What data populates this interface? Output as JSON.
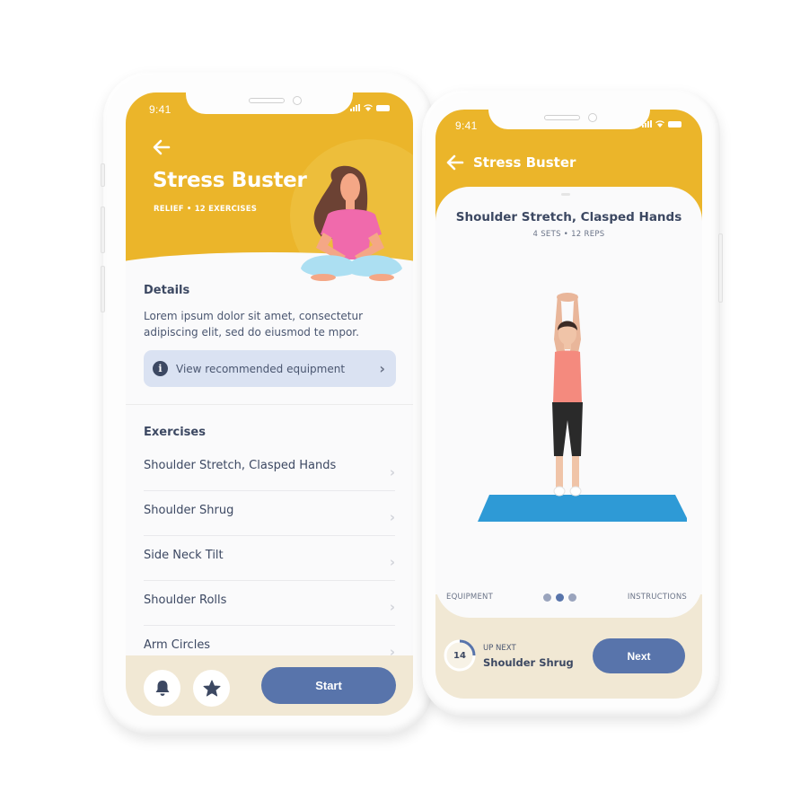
{
  "colors": {
    "accent_yellow": "#ebb52a",
    "primary_blue": "#5874ab",
    "text_dark": "#3c4862",
    "bottom_bar": "#f1e8d4",
    "info_bg": "#dae2f2"
  },
  "phone_overview": {
    "status_bar": {
      "time": "9:41"
    },
    "header": {
      "back_icon": "arrow-left-icon",
      "title": "Stress Buster",
      "subtitle": "RELIEF • 12 EXERCISES"
    },
    "details": {
      "heading": "Details",
      "body": "Lorem ipsum dolor sit amet, consectetur adipiscing elit, sed do eiusmod te mpor.",
      "equipment_link": "View recommended equipment"
    },
    "exercises": {
      "heading": "Exercises",
      "items": [
        {
          "label": "Shoulder Stretch, Clasped Hands"
        },
        {
          "label": "Shoulder Shrug"
        },
        {
          "label": "Side Neck Tilt"
        },
        {
          "label": "Shoulder Rolls"
        },
        {
          "label": "Arm Circles"
        }
      ]
    },
    "bottom_bar": {
      "reminder_icon": "bell-icon",
      "favorite_icon": "star-icon",
      "start_label": "Start"
    }
  },
  "phone_exercise": {
    "status_bar": {
      "time": "9:41"
    },
    "header": {
      "back_icon": "arrow-left-icon",
      "title": "Stress Buster"
    },
    "exercise": {
      "title": "Shoulder Stretch, Clasped Hands",
      "meta": "4 SETS • 12 REPS"
    },
    "pager": {
      "left_label": "EQUIPMENT",
      "right_label": "INSTRUCTIONS",
      "page_count": 3,
      "active_index": 1
    },
    "up_next": {
      "timer_value": "14",
      "timer_progress": 0.25,
      "label": "UP NEXT",
      "name": "Shoulder Shrug",
      "next_label": "Next"
    }
  }
}
